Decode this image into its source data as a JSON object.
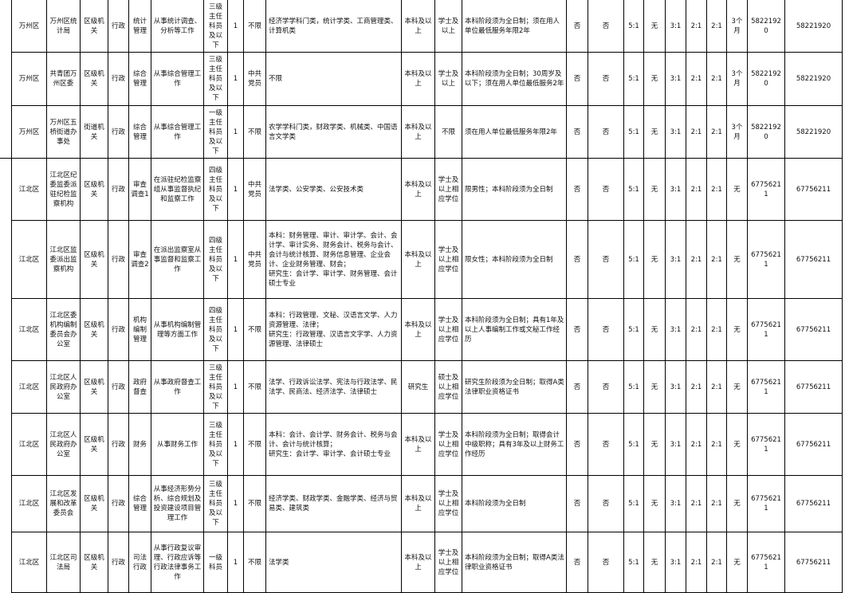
{
  "rows": [
    [
      "万州区",
      "万州区统计局",
      "区级机关",
      "行政",
      "统计管理",
      "从事统计调查、分析等工作",
      "三级主任科员及以下",
      "1",
      "不限",
      "经济学学科门类，统计学类、工商管理类、计算机类",
      "本科及以上",
      "学士及以上",
      "本科阶段须为全日制；须在用人单位最低服务年限2年",
      "否",
      "否",
      "5:1",
      "无",
      "3:1",
      "2:1",
      "2:1",
      "3个月",
      "58221920",
      "58221920"
    ],
    [
      "万州区",
      "共青团万州区委",
      "区级机关",
      "行政",
      "综合管理",
      "从事综合管理工作",
      "三级主任科员及以下",
      "1",
      "中共党员",
      "不限",
      "本科及以上",
      "学士及以上",
      "本科阶段须为全日制；30周岁及以下；须在用人单位最低服务2年",
      "否",
      "否",
      "5:1",
      "无",
      "3:1",
      "2:1",
      "2:1",
      "3个月",
      "58221920",
      "58221920"
    ],
    [
      "万州区",
      "万州区五桥街道办事处",
      "街道机关",
      "行政",
      "综合管理",
      "从事综合管理工作",
      "一级主任科员及以下",
      "1",
      "不限",
      "农学学科门类，财政学类、机械类、中国语言文学类",
      "本科及以上",
      "不限",
      "须在用人单位最低服务年限2年",
      "否",
      "否",
      "5:1",
      "无",
      "3:1",
      "2:1",
      "2:1",
      "3个月",
      "58221920",
      "58221920"
    ],
    [
      "江北区",
      "江北区纪委监委派驻纪检监察机构",
      "区级机关",
      "行政",
      "审查调查1",
      "在派驻纪检监察组从事监督执纪和监察工作",
      "四级主任科员及以下",
      "1",
      "中共党员",
      "法学类、公安学类、公安技术类",
      "本科及以上",
      "学士及以上相应学位",
      "限男性；本科阶段须为全日制",
      "否",
      "否",
      "5:1",
      "无",
      "3:1",
      "2:1",
      "2:1",
      "无",
      "67756211",
      "67756211"
    ],
    [
      "江北区",
      "江北区监委派出监察机构",
      "区级机关",
      "行政",
      "审查调查2",
      "在派出监察室从事监督和监察工作",
      "四级主任科员及以下",
      "1",
      "中共党员",
      "本科：财务管理、审计、审计学、会计、会计学、审计实务、财务会计、税务与会计、会计与统计核算、财务信息管理、企业会计、企业财务管理、财会；\n研究生：会计学、审计学、财务管理、会计硕士专业",
      "本科及以上",
      "学士及以上相应学位",
      "限女性；本科阶段须为全日制",
      "否",
      "否",
      "5:1",
      "无",
      "3:1",
      "2:1",
      "2:1",
      "无",
      "67756211",
      "67756211"
    ],
    [
      "江北区",
      "江北区委机构编制委员会办公室",
      "区级机关",
      "行政",
      "机构编制管理",
      "从事机构编制管理等方面工作",
      "四级主任科员及以下",
      "1",
      "不限",
      "本科：行政管理、文秘、汉语言文学、人力资源管理、法律；\n研究生：行政管理、汉语言文字学、人力资源管理、法律硕士",
      "本科及以上",
      "学士及以上相应学位",
      "本科阶段须为全日制；具有1年及以上人事编制工作或文秘工作经历",
      "否",
      "否",
      "5:1",
      "无",
      "3:1",
      "2:1",
      "2:1",
      "无",
      "67756211",
      "67756211"
    ],
    [
      "江北区",
      "江北区人民政府办公室",
      "区级机关",
      "行政",
      "政府督查",
      "从事政府督查工作",
      "三级主任科员及以下",
      "1",
      "不限",
      "法学、行政诉讼法学、宪法与行政法学、民法学、民商法、经济法学、法律硕士",
      "研究生",
      "硕士及以上相应学位",
      "研究生阶段须为全日制；取得A类法律职业资格证书",
      "否",
      "否",
      "5:1",
      "无",
      "3:1",
      "2:1",
      "2:1",
      "无",
      "67756211",
      "67756211"
    ],
    [
      "江北区",
      "江北区人民政府办公室",
      "区级机关",
      "行政",
      "财务",
      "从事财务工作",
      "三级主任科员及以下",
      "1",
      "不限",
      "本科：会计、会计学、财务会计、税务与会计、会计与统计核算；\n研究生：会计学、审计学、会计硕士专业",
      "本科及以上",
      "学士及以上相应学位",
      "本科阶段须为全日制；取得会计中级职称；具有3年及以上财务工作经历",
      "否",
      "否",
      "5:1",
      "无",
      "3:1",
      "2:1",
      "2:1",
      "无",
      "67756211",
      "67756211"
    ],
    [
      "江北区",
      "江北区发展和改革委员会",
      "区级机关",
      "行政",
      "综合管理",
      "从事经济形势分析、综合规划及投资建设项目管理工作",
      "三级主任科员及以下",
      "1",
      "不限",
      "经济学类、财政学类、金融学类、经济与贸易类、建筑类",
      "本科及以上",
      "学士及以上相应学位",
      "本科阶段须为全日制",
      "否",
      "否",
      "5:1",
      "无",
      "3:1",
      "2:1",
      "2:1",
      "无",
      "67756211",
      "67756211"
    ],
    [
      "江北区",
      "江北区司法局",
      "区级机关",
      "行政",
      "司法行政",
      "从事行政复议审理、行政应诉等行政法律事务工作",
      "一级科员",
      "1",
      "不限",
      "法学类",
      "本科及以上",
      "学士及以上相应学位",
      "本科阶段须为全日制；取得A类法律职业资格证书",
      "否",
      "否",
      "5:1",
      "无",
      "3:1",
      "2:1",
      "2:1",
      "无",
      "67756211",
      "67756211"
    ]
  ]
}
